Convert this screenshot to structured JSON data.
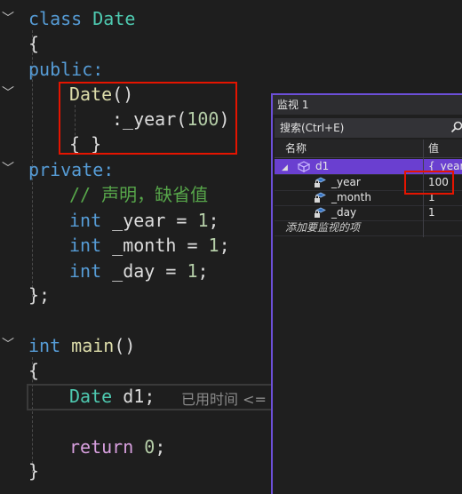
{
  "code": {
    "l1_kw": "class",
    "l1_name": "Date",
    "l2": "{",
    "l3": "public:",
    "l4_ctor": "Date",
    "l4_paren": "()",
    "l5_colon": ":",
    "l5_member": "_year",
    "l5_open": "(",
    "l5_val": "100",
    "l5_close": ")",
    "l6": "{ }",
    "l7": "private:",
    "l8": "// 声明，缺省值",
    "l9_type": "int",
    "l9_rest": " _year = ",
    "l9_val": "1",
    "l9_end": ";",
    "l10_type": "int",
    "l10_rest": " _month = ",
    "l10_val": "1",
    "l10_end": ";",
    "l11_type": "int",
    "l11_rest": " _day = ",
    "l11_val": "1",
    "l11_end": ";",
    "l12": "};",
    "l13_type": "int",
    "l13_fn": "main",
    "l13_paren": "()",
    "l14": "{",
    "l15_type": "Date",
    "l15_var": "d1",
    "l15_end": ";",
    "l15_hint": "已用时间 <=",
    "l16_kw": "return",
    "l16_val": "0",
    "l16_end": ";",
    "l17": "}"
  },
  "watch": {
    "title": "监视 1",
    "search_placeholder": "搜索(Ctrl+E)",
    "col_name": "名称",
    "col_value": "值",
    "rows": [
      {
        "name": "d1",
        "value": "{_year="
      },
      {
        "name": "_year",
        "value": "100"
      },
      {
        "name": "_month",
        "value": "1"
      },
      {
        "name": "_day",
        "value": "1"
      }
    ],
    "add_item": "添加要监视的项"
  },
  "colors": {
    "keyword": "#569cd6",
    "type": "#4ec9b0",
    "number": "#b5cea8",
    "comment": "#57a64a",
    "highlight_box": "#e51400",
    "selection": "#6a3fd0"
  }
}
